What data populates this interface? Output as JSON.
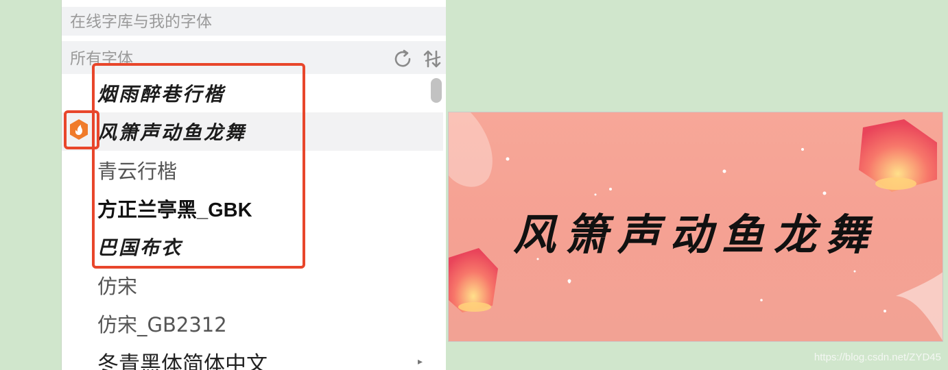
{
  "panel": {
    "online_section_label": "在线字库与我的字体",
    "all_fonts_label": "所有字体",
    "toolbar_icons": [
      "refresh-icon",
      "swap-sort-icon"
    ]
  },
  "fonts": [
    {
      "label": "烟雨醉巷行楷",
      "style": "brush",
      "highlighted": false
    },
    {
      "label": "风箫声动鱼龙舞",
      "style": "brush",
      "highlighted": true,
      "badge_icon": "online-font-flame-icon"
    },
    {
      "label": "青云行楷",
      "style": "song",
      "highlighted": false
    },
    {
      "label": "方正兰亭黑_GBK",
      "style": "sans-bold",
      "highlighted": false
    },
    {
      "label": "巴国布衣",
      "style": "brush",
      "highlighted": false
    },
    {
      "label": "仿宋",
      "style": "song",
      "highlighted": false
    },
    {
      "label": "仿宋_GB2312",
      "style": "thin",
      "highlighted": false
    },
    {
      "label": "冬青黑体简体中文",
      "style": "sans",
      "highlighted": false,
      "has_submenu": true
    }
  ],
  "preview": {
    "text": "风箫声动鱼龙舞",
    "background_color": "#f5a193"
  },
  "watermark": "https://blog.csdn.net/ZYD45",
  "colors": {
    "annotation_red": "#e8462b",
    "badge_orange": "#f07b2a",
    "page_background": "#d0e6cc"
  }
}
